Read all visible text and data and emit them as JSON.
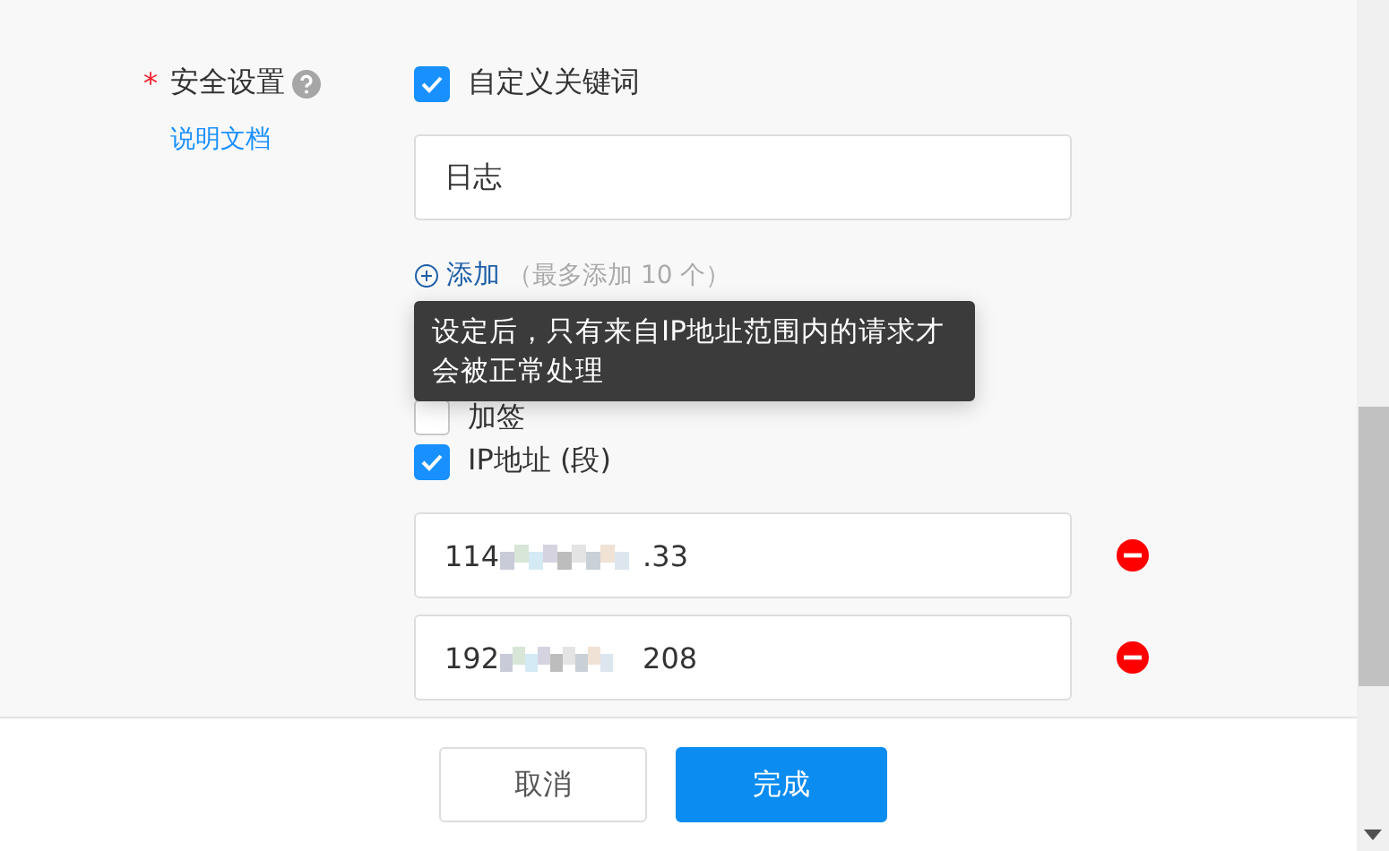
{
  "security": {
    "required_mark": "*",
    "label": "安全设置",
    "doc_link": "说明文档",
    "options": [
      {
        "kind": "keywords",
        "label": "自定义关键词",
        "checked": true,
        "values": [
          "日志"
        ],
        "add_link": "添加",
        "add_hint": "（最多添加 10 个）"
      },
      {
        "kind": "sign",
        "label": "加签",
        "checked": false
      },
      {
        "kind": "ip",
        "label": "IP地址 (段)",
        "checked": true,
        "ips": [
          {
            "start": "114",
            "end": ".33"
          },
          {
            "start": "192",
            "end": "208"
          }
        ]
      }
    ]
  },
  "tooltip": "设定后，只有来自IP地址范围内的请求才会被正常处理",
  "footer": {
    "cancel": "取消",
    "done": "完成"
  }
}
